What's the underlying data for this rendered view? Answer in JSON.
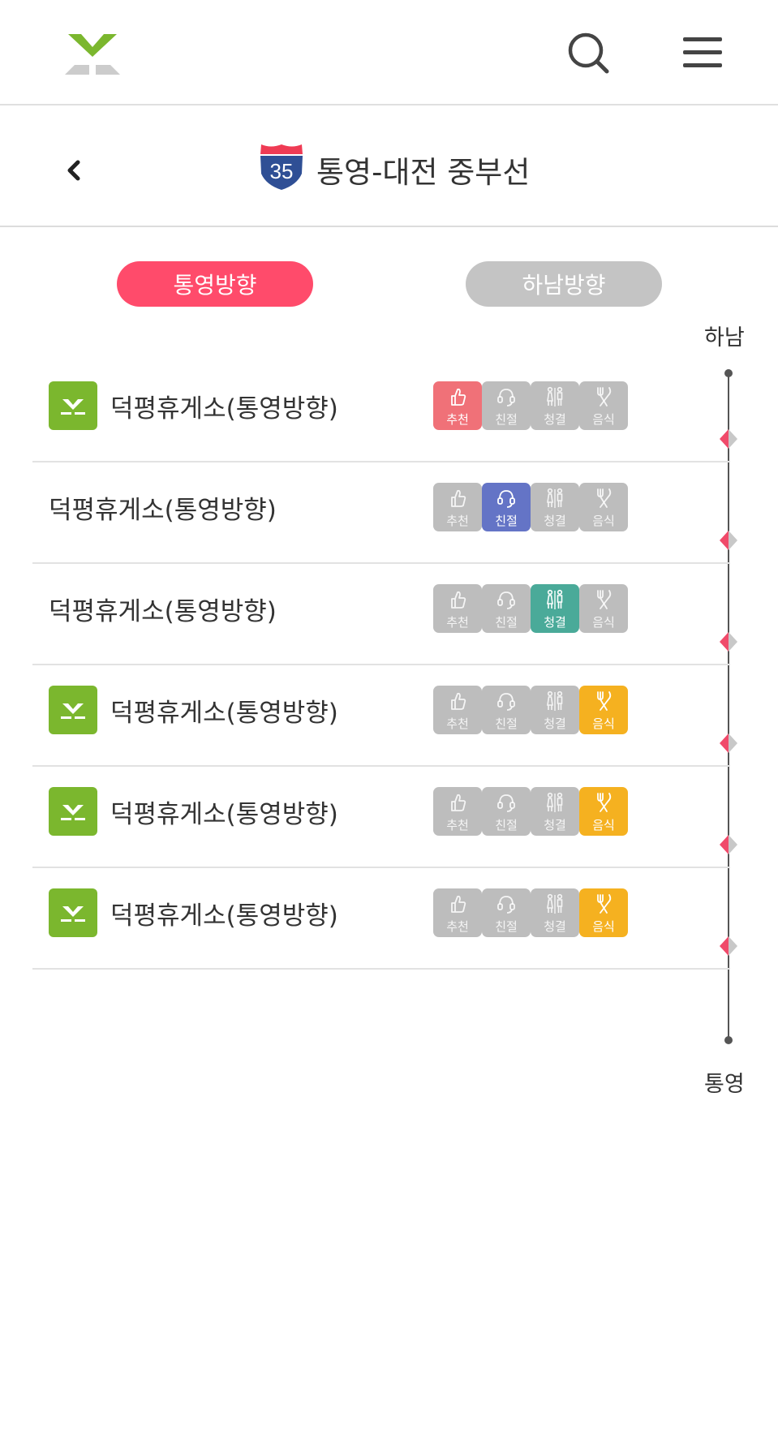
{
  "header": {
    "logo_name": "highway-logo",
    "search_icon": "search-icon",
    "menu_icon": "menu-icon"
  },
  "route": {
    "number": "35",
    "title": "통영-대전 중부선"
  },
  "tabs": [
    {
      "label": "통영방향",
      "active": true,
      "color": "#ff4b6b"
    },
    {
      "label": "하남방향",
      "active": false,
      "color": "#c4c4c4"
    }
  ],
  "timeline": {
    "start_label": "하남",
    "end_label": "통영",
    "marker_color": "#f04a6a"
  },
  "badge_labels": {
    "recommend": "추천",
    "kind": "친절",
    "clean": "청결",
    "food": "음식"
  },
  "badge_colors": {
    "recommend": "#f07178",
    "kind": "#6474c6",
    "clean": "#4aaa99",
    "food": "#f5b120",
    "off": "#bdbdbd"
  },
  "rest_areas": [
    {
      "name": "덕평휴게소(통영방향)",
      "has_brand_icon": true,
      "active_badge": "recommend"
    },
    {
      "name": "덕평휴게소(통영방향)",
      "has_brand_icon": false,
      "active_badge": "kind"
    },
    {
      "name": "덕평휴게소(통영방향)",
      "has_brand_icon": false,
      "active_badge": "clean"
    },
    {
      "name": "덕평휴게소(통영방향)",
      "has_brand_icon": true,
      "active_badge": "food"
    },
    {
      "name": "덕평휴게소(통영방향)",
      "has_brand_icon": true,
      "active_badge": "food"
    },
    {
      "name": "덕평휴게소(통영방향)",
      "has_brand_icon": true,
      "active_badge": "food"
    }
  ]
}
